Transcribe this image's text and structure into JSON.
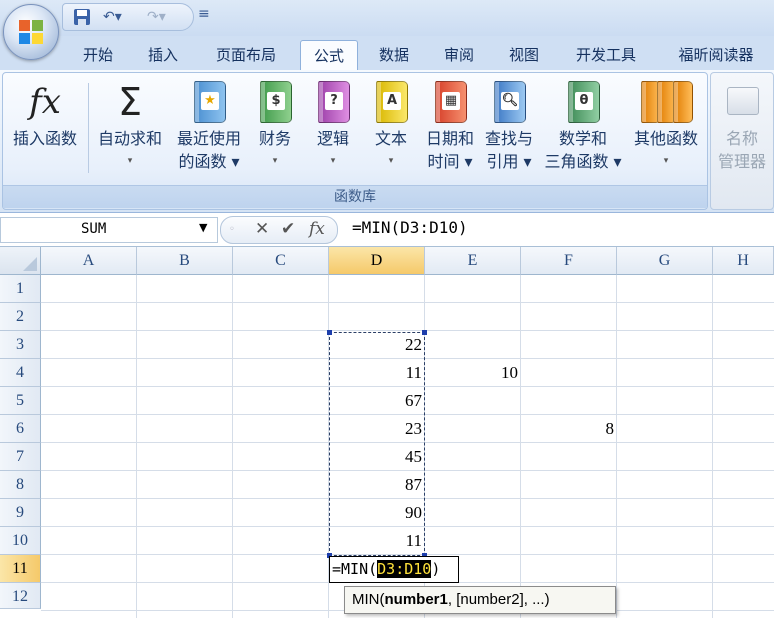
{
  "tabs": [
    "开始",
    "插入",
    "页面布局",
    "公式",
    "数据",
    "审阅",
    "视图",
    "开发工具",
    "福昕阅读器"
  ],
  "active_tab": "公式",
  "ribbon": {
    "group_label": "函数库",
    "buttons": [
      {
        "line1": "插入函数",
        "line2": ""
      },
      {
        "line1": "自动求和",
        "line2": "▾"
      },
      {
        "line1": "最近使用",
        "line2": "的函数 ▾"
      },
      {
        "line1": "财务",
        "line2": "▾"
      },
      {
        "line1": "逻辑",
        "line2": "▾"
      },
      {
        "line1": "文本",
        "line2": "▾"
      },
      {
        "line1": "日期和",
        "line2": "时间 ▾"
      },
      {
        "line1": "查找与",
        "line2": "引用 ▾"
      },
      {
        "line1": "数学和",
        "line2": "三角函数 ▾"
      },
      {
        "line1": "其他函数",
        "line2": "▾"
      }
    ],
    "name_manager": {
      "line1": "名称",
      "line2": "管理器"
    }
  },
  "formula_bar": {
    "name_box": "SUM",
    "formula": "=MIN(D3:D10)"
  },
  "columns": [
    "A",
    "B",
    "C",
    "D",
    "E",
    "F",
    "G",
    "H"
  ],
  "selected_column": "D",
  "rows": [
    "1",
    "2",
    "3",
    "4",
    "5",
    "6",
    "7",
    "8",
    "9",
    "10",
    "11",
    "12"
  ],
  "selected_row": "11",
  "cells": [
    {
      "ref": "D3",
      "value": "22"
    },
    {
      "ref": "D4",
      "value": "11"
    },
    {
      "ref": "E4",
      "value": "10"
    },
    {
      "ref": "D5",
      "value": "67"
    },
    {
      "ref": "D6",
      "value": "23"
    },
    {
      "ref": "F6",
      "value": "8"
    },
    {
      "ref": "D7",
      "value": "45"
    },
    {
      "ref": "D8",
      "value": "87"
    },
    {
      "ref": "D9",
      "value": "90"
    },
    {
      "ref": "D10",
      "value": "11"
    }
  ],
  "edit_cell": {
    "prefix": "=MIN(",
    "highlight": "D3:D10",
    "suffix": ")"
  },
  "tooltip": {
    "func": "MIN(",
    "arg1": "number1",
    "rest": ", [number2], ...)"
  }
}
